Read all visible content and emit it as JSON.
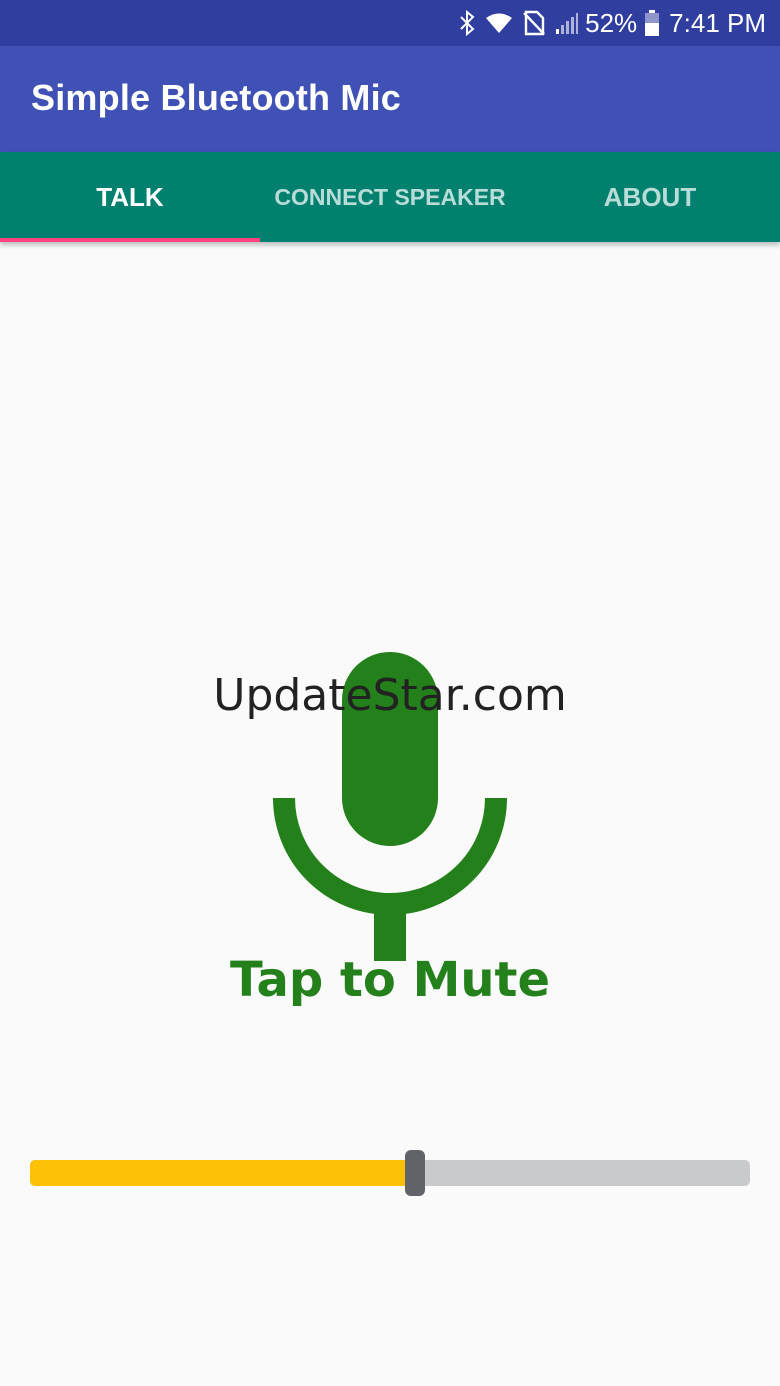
{
  "status_bar": {
    "battery_percent": "52%",
    "time": "7:41 PM",
    "icons": [
      "bluetooth-icon",
      "wifi-icon",
      "no-sim-icon",
      "signal-icon",
      "battery-icon"
    ]
  },
  "app_bar": {
    "title": "Simple Bluetooth Mic"
  },
  "tabs": [
    {
      "label": "TALK",
      "active": true
    },
    {
      "label": "CONNECT SPEAKER",
      "active": false
    },
    {
      "label": "ABOUT",
      "active": false
    }
  ],
  "watermark": "UpdateStar.com",
  "mic": {
    "icon": "microphone-icon",
    "label": "Tap to Mute",
    "color": "#23801a"
  },
  "volume_slider": {
    "value_fraction": 0.535,
    "fill_color": "#ffc107",
    "track_color": "#c9cacd"
  },
  "colors": {
    "status_bar": "#303f9f",
    "app_bar": "#3f51b5",
    "tab_bar": "#00806f",
    "tab_indicator": "#ff4081"
  }
}
